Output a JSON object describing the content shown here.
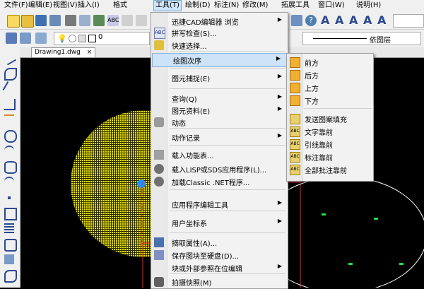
{
  "menubar": [
    "文件(F)",
    "编辑(E)",
    "视图(V)",
    "插入(I)",
    "格式",
    "工具(T)",
    "绘制(D)",
    "标注(N)",
    "修改(M)",
    "拓展工具",
    "窗口(W)",
    "说明(H)"
  ],
  "toolbar": {
    "layer_value": "0",
    "linetype_value": "依图层"
  },
  "tab": {
    "label": "Drawing1.dwg",
    "close": "×"
  },
  "tools_menu": {
    "items": [
      {
        "label": "迅捷CAD编辑器 浏览",
        "icon": "blank",
        "arrow": true
      },
      {
        "label": "拼写检查(S)...",
        "icon": "spellcheck-icon"
      },
      {
        "label": "快速选择...",
        "icon": "quick-select-icon"
      },
      {
        "label": "绘图次序",
        "icon": "blank",
        "arrow": true,
        "highlight": true
      },
      {
        "label": "图元捕捉(E)",
        "icon": "blank",
        "arrow": true
      },
      {
        "label": "查询(Q)",
        "icon": "blank",
        "arrow": true
      },
      {
        "label": "图元资料(E)",
        "icon": "blank",
        "arrow": true
      },
      {
        "label": "动态",
        "icon": "speaker-icon"
      },
      {
        "label": "动作记录",
        "icon": "blank",
        "arrow": true
      },
      {
        "label": "载入功能表...",
        "icon": "menu-load-icon"
      },
      {
        "label": "载入LISP或SDS应用程序(L)...",
        "icon": "gears-icon"
      },
      {
        "label": "加载Classic .NET程序...",
        "icon": "gears-icon"
      },
      {
        "label": "应用程序编辑工具",
        "icon": "blank",
        "arrow": true
      },
      {
        "label": "用户坐标系",
        "icon": "blank",
        "arrow": true
      },
      {
        "label": "摘取属性(A)...",
        "icon": "extract-attr-icon"
      },
      {
        "label": "保存图块至硬盘(D)...",
        "icon": "save-block-icon"
      },
      {
        "label": "块或外部参照在位编辑",
        "icon": "blank",
        "arrow": true
      },
      {
        "label": "拍摄快照(M)",
        "icon": "camera-icon"
      }
    ]
  },
  "draw_order_submenu": {
    "items": [
      "前方",
      "后方",
      "上方",
      "下方",
      "发送图案填充",
      "文字靠前",
      "引线靠前",
      "标注靠前",
      "全部批注靠前"
    ]
  }
}
